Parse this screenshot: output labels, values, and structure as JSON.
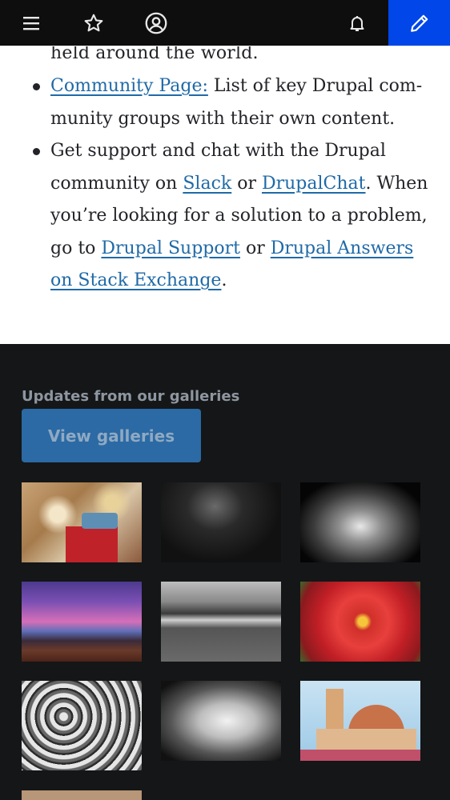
{
  "toolbar": {
    "icons": [
      "menu-icon",
      "star-icon",
      "user-icon",
      "bell-icon",
      "pencil-icon"
    ],
    "accent_color": "#0046e8"
  },
  "content": {
    "cut_off_line": "held around the world.",
    "items": [
      {
        "link1": "Community Page:",
        "text1": " List of key Drupal com-munity groups with their own content."
      },
      {
        "text1": "Get support and chat with the Drupal community on ",
        "link1": "Slack",
        "text2": " or ",
        "link2": "DrupalChat",
        "text3": ". When you’re looking for a solution to a problem, go to ",
        "link3": "Drupal Support",
        "text4": " or ",
        "link4": "Drupal Answers on Stack Exchange",
        "text5": "."
      }
    ],
    "link_color": "#1f6aa7"
  },
  "galleries": {
    "heading": "Updates from our galleries",
    "button_label": "View galleries",
    "button_color": "#2b6aa4"
  }
}
